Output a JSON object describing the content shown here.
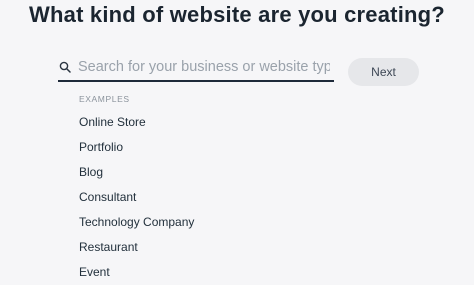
{
  "header": {
    "title": "What kind of website are you creating?"
  },
  "search": {
    "icon": "search-icon",
    "value": "",
    "placeholder": "Search for your business or website type",
    "underline_color": "#1e2a3a"
  },
  "next_button": {
    "label": "Next",
    "background": "#e6e7ea"
  },
  "examples": {
    "heading": "EXAMPLES",
    "items": [
      {
        "label": "Online Store"
      },
      {
        "label": "Portfolio"
      },
      {
        "label": "Blog"
      },
      {
        "label": "Consultant"
      },
      {
        "label": "Technology Company"
      },
      {
        "label": "Restaurant"
      },
      {
        "label": "Event"
      }
    ]
  }
}
